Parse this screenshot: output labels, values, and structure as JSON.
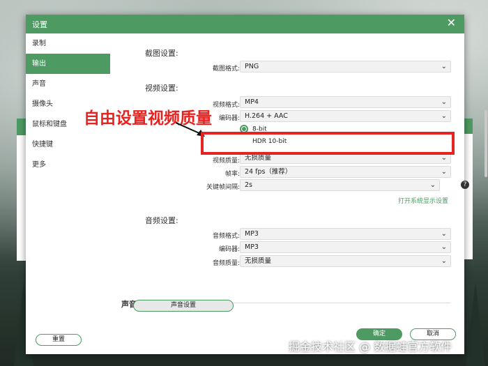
{
  "dialog": {
    "title": "设置",
    "close_glyph": "✕"
  },
  "sidebar": {
    "items": [
      {
        "label": "录制"
      },
      {
        "label": "输出"
      },
      {
        "label": "声音"
      },
      {
        "label": "摄像头"
      },
      {
        "label": "鼠标和键盘"
      },
      {
        "label": "快捷键"
      },
      {
        "label": "更多"
      }
    ],
    "active_index": 1
  },
  "screenshot_settings": {
    "section_title": "截图设置:",
    "format_label": "截图格式:",
    "format_value": "PNG"
  },
  "video_settings": {
    "section_title": "视频设置:",
    "format_label": "视频格式:",
    "format_value": "MP4",
    "encoder_label": "编码器:",
    "encoder_value": "H.264 + AAC",
    "bitdepth_options": [
      "8-bit",
      "HDR 10-bit"
    ],
    "bitdepth_selected": "8-bit",
    "quality_label": "视频质量:",
    "quality_value": "无损质量",
    "framerate_label": "帧率:",
    "framerate_value": "24 fps（推荐）",
    "keyframe_label": "关键帧间隔:",
    "keyframe_value": "2s",
    "help_glyph": "?",
    "display_link": "打开系统显示设置"
  },
  "audio_settings": {
    "section_title": "音频设置:",
    "format_label": "音频格式:",
    "format_value": "MP3",
    "encoder_label": "编码器:",
    "encoder_value": "MP3",
    "quality_label": "音频质量:",
    "quality_value": "无损质量"
  },
  "sound": {
    "section_title": "声音",
    "button_label": "声音设置"
  },
  "footer": {
    "reset_label": "重置",
    "ok_label": "确定",
    "cancel_label": "取消"
  },
  "annotation": {
    "text": "自由设置视频质量",
    "color": "#e52320"
  },
  "watermark": "掘金技术社区 @ 数据蛙官方软件",
  "colors": {
    "accent": "#4e9a63"
  },
  "icons": {
    "chevron": "chevron-down-icon",
    "close": "close-icon",
    "help": "help-icon"
  }
}
